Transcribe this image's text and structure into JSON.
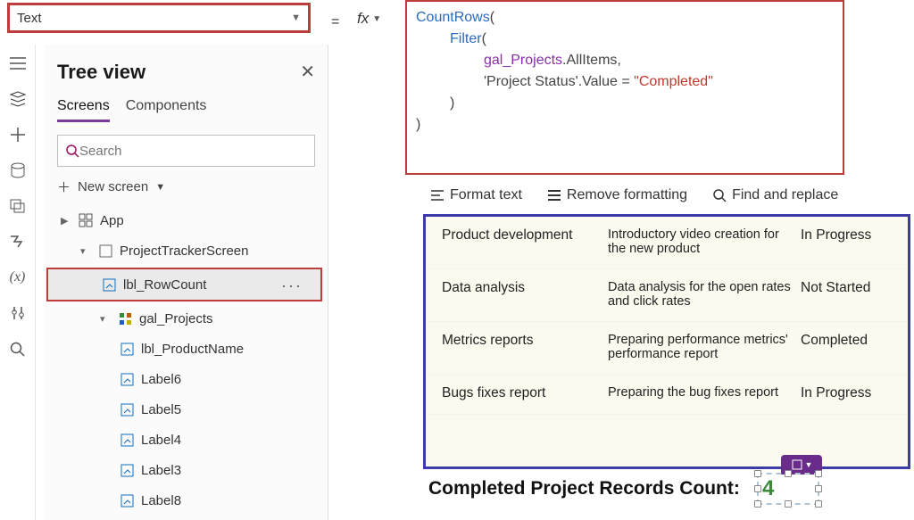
{
  "propertyDropdown": {
    "value": "Text"
  },
  "formula": {
    "l1a": "CountRows",
    "l1b": "(",
    "l2a": "Filter",
    "l2b": "(",
    "l3a": "gal_Projects",
    "l3b": ".AllItems,",
    "l4a": "'Project Status'",
    "l4b": ".Value = ",
    "l4c": "\"Completed\"",
    "l5": ")",
    "l6": ")"
  },
  "fbar": {
    "format": "Format text",
    "remove": "Remove formatting",
    "find": "Find and replace"
  },
  "tree": {
    "title": "Tree view",
    "tabs": {
      "screens": "Screens",
      "components": "Components"
    },
    "searchPlaceholder": "Search",
    "newScreen": "New screen",
    "app": "App",
    "screen": "ProjectTrackerScreen",
    "selected": "lbl_RowCount",
    "gal": "gal_Projects",
    "children": {
      "c0": "lbl_ProductName",
      "c1": "Label6",
      "c2": "Label5",
      "c3": "Label4",
      "c4": "Label3",
      "c5": "Label8"
    }
  },
  "rows": {
    "r0": {
      "name": "Product development",
      "desc": "Introductory video creation for the new product",
      "status": "In Progress"
    },
    "r1": {
      "name": "Data analysis",
      "desc": "Data analysis for the open rates and click rates",
      "status": "Not Started"
    },
    "r2": {
      "name": "Metrics reports",
      "desc": "Preparing performance metrics' performance report",
      "status": "Completed"
    },
    "r3": {
      "name": "Bugs fixes report",
      "desc": "Preparing the bug fixes report",
      "status": "In Progress"
    }
  },
  "countLabel": "Completed Project Records Count:",
  "countValue": "4"
}
